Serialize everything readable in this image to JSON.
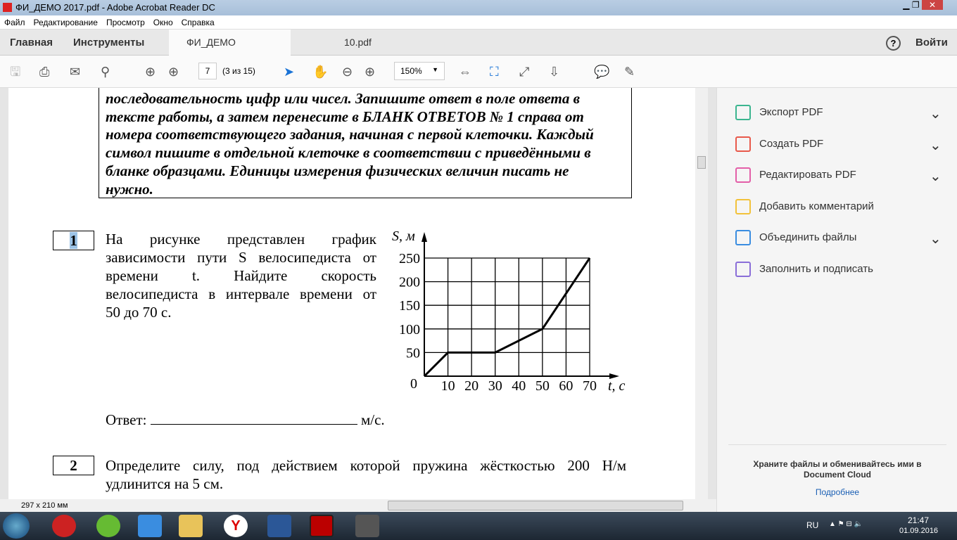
{
  "window": {
    "title": "ФИ_ДЕМО 2017.pdf - Adobe Acrobat Reader DC"
  },
  "menu": [
    "Файл",
    "Редактирование",
    "Просмотр",
    "Окно",
    "Справка"
  ],
  "tabs": {
    "home": "Главная",
    "tools": "Инструменты",
    "doc1": "ФИ_ДЕМО 2017.pdf",
    "doc2": "10.pdf",
    "help": "?",
    "login": "Войти"
  },
  "toolbar": {
    "page": "7",
    "page_of": "(3 из 15)",
    "zoom": "150%"
  },
  "doc": {
    "instructions": [
      "последовательность цифр или чисел. Запишите ответ в поле ответа в",
      "тексте работы, а затем перенесите в БЛАНК ОТВЕТОВ № 1 справа от",
      "номера соответствующего задания, начиная с первой клеточки. Каждый",
      "символ пишите в отдельной клеточке в соответствии с приведёнными в",
      "бланке образцами. Единицы измерения физических величин писать не",
      "нужно."
    ],
    "q1_num": "1",
    "q1_lines": [
      "На рисунке представлен график",
      "зависимости пути S велосипедиста от",
      "времени t. Найдите скорость",
      "велосипедиста в интервале времени от",
      "50 до 70 с."
    ],
    "answer_label": "Ответ:",
    "answer_unit": "м/с.",
    "q2_num": "2",
    "q2_lines": [
      "Определите силу, под действием которой пружина жёсткостью 200 Н/м",
      "удлинится на 5 см."
    ],
    "page_size": "297 x 210 мм"
  },
  "chart_data": {
    "type": "line",
    "xlabel": "t, с",
    "ylabel": "S, м",
    "x_ticks": [
      10,
      20,
      30,
      40,
      50,
      60,
      70
    ],
    "y_ticks": [
      50,
      100,
      150,
      200,
      250
    ],
    "origin_label": "0",
    "xlim": [
      0,
      70
    ],
    "ylim": [
      0,
      250
    ],
    "x": [
      0,
      10,
      30,
      50,
      70
    ],
    "y": [
      0,
      50,
      50,
      100,
      250
    ],
    "grid": true
  },
  "right_panel": {
    "items": [
      {
        "label": "Экспорт PDF",
        "color": "#3bb58f",
        "chev": true
      },
      {
        "label": "Создать PDF",
        "color": "#e8594b",
        "chev": true
      },
      {
        "label": "Редактировать PDF",
        "color": "#e35fa8",
        "chev": true
      },
      {
        "label": "Добавить комментарий",
        "color": "#f2c23a",
        "chev": false
      },
      {
        "label": "Объединить файлы",
        "color": "#3a8de0",
        "chev": true
      },
      {
        "label": "Заполнить и подписать",
        "color": "#8a6ed8",
        "chev": false
      }
    ],
    "cloud_text": "Храните файлы и обменивайтесь ими в Document Cloud",
    "more": "Подробнее"
  },
  "taskbar": {
    "lang": "RU",
    "time": "21:47",
    "date": "01.09.2016"
  }
}
